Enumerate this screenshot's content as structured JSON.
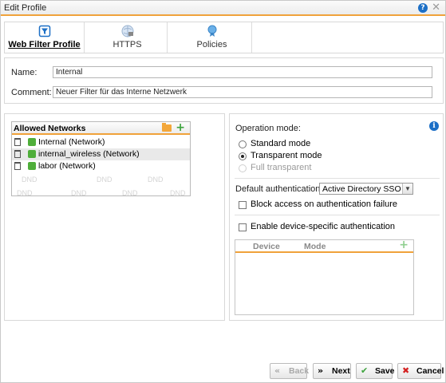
{
  "window": {
    "title": "Edit Profile",
    "help_icon": "?",
    "close_icon": "✕"
  },
  "tabs": [
    {
      "label": "Web Filter Profile",
      "icon": "filter-icon",
      "active": true
    },
    {
      "label": "HTTPS",
      "icon": "https-icon",
      "active": false
    },
    {
      "label": "Policies",
      "icon": "policies-icon",
      "active": false
    }
  ],
  "form": {
    "name_label": "Name:",
    "name_value": "Internal",
    "comment_label": "Comment:",
    "comment_value": "Neuer Filter für das Interne Netzwerk"
  },
  "allowed_networks": {
    "header": "Allowed Networks",
    "items": [
      {
        "label": "Internal (Network)"
      },
      {
        "label": "internal_wireless (Network)"
      },
      {
        "label": "labor (Network)"
      }
    ],
    "dnd_label": "DND"
  },
  "settings": {
    "operation_mode_label": "Operation mode:",
    "modes": [
      {
        "label": "Standard mode",
        "selected": false,
        "disabled": false
      },
      {
        "label": "Transparent mode",
        "selected": true,
        "disabled": false
      },
      {
        "label": "Full transparent",
        "selected": false,
        "disabled": true
      }
    ],
    "default_auth_label": "Default authentication:",
    "default_auth_value": "Active Directory SSO",
    "block_access_label": "Block access on authentication failure",
    "block_access_checked": false,
    "device_auth_label": "Enable device-specific authentication",
    "device_auth_checked": false,
    "device_table": {
      "col_device": "Device",
      "col_mode": "Mode"
    }
  },
  "buttons": {
    "back": "Back",
    "next": "Next",
    "save": "Save",
    "cancel": "Cancel"
  },
  "colors": {
    "accent": "#f0a23a",
    "info": "#1c6fc6",
    "add": "#3da33d",
    "cancel": "#d42020"
  }
}
